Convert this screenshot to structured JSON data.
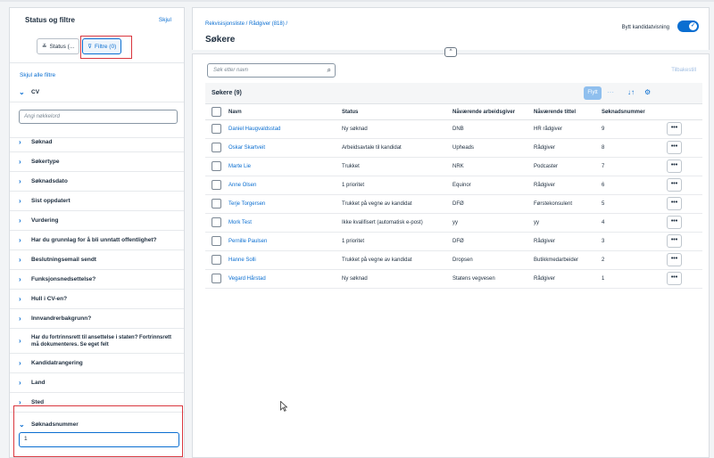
{
  "sidebar": {
    "title": "Status og filtre",
    "hide_label": "Skjul",
    "segments": [
      {
        "icon": "list-filter-icon",
        "glyph": "≚",
        "label": "Status (..."
      },
      {
        "icon": "funnel-icon",
        "glyph": "⊽",
        "label": "Filtre (0)"
      }
    ],
    "hide_all_label": "Skjul alle filtre",
    "cv_label": "CV",
    "keyword_placeholder": "Angi nøkkelord",
    "filters": [
      "Søknad",
      "Søkertype",
      "Søknadsdato",
      "Sist oppdatert",
      "Vurdering",
      "Har du grunnlag for å bli unntatt offentlighet?",
      "Beslutningsemail sendt",
      "Funksjonsnedsettelse?",
      "Hull i CV-en?",
      "Innvandrerbakgrunn?",
      "Har du fortrinnsrett til ansettelse i staten? Fortrinnsrett må dokumenteres. Se eget felt",
      "Kandidatrangering",
      "Land",
      "Sted"
    ],
    "expanded_filter": "Søknadsnummer",
    "expanded_value": "1"
  },
  "header": {
    "breadcrumb": "Rekvisisjonsliste / Rådgiver (818) /",
    "title": "Søkere",
    "switch_label": "Bytt kandidatvisning",
    "switch_glyph": "✓"
  },
  "toolbar": {
    "search_placeholder": "Søk etter navn",
    "reset_label": "Tilbakestill",
    "table_title": "Søkere (9)",
    "move_label": "Flytt",
    "more_glyph": "···",
    "sort_glyph": "↓↑",
    "settings_glyph": "⚙"
  },
  "table": {
    "columns": [
      "Navn",
      "Status",
      "Nåværende arbeidsgiver",
      "Nåværende tittel",
      "Søknadsnummer"
    ],
    "rows": [
      {
        "name": "Daniel Haugvaldsstad",
        "status": "Ny søknad",
        "employer": "DNB",
        "title": "HR rådgiver",
        "number": "9"
      },
      {
        "name": "Oskar Skartveit",
        "status": "Arbeidsavtale til kandidat",
        "employer": "Upheads",
        "title": "Rådgiver",
        "number": "8"
      },
      {
        "name": "Marte Lie",
        "status": "Trukket",
        "employer": "NRK",
        "title": "Podcaster",
        "number": "7"
      },
      {
        "name": "Anne Olsen",
        "status": "1 prioritet",
        "employer": "Equinor",
        "title": "Rådgiver",
        "number": "6"
      },
      {
        "name": "Terje Torgersen",
        "status": "Trukket på vegne av kandidat",
        "employer": "DFØ",
        "title": "Førstekonsulent",
        "number": "5"
      },
      {
        "name": "Mork Test",
        "status": "Ikke kvalifisert (automatisk e-post)",
        "employer": "yy",
        "title": "yy",
        "number": "4"
      },
      {
        "name": "Pernille Paulsen",
        "status": "1 prioritet",
        "employer": "DFØ",
        "title": "Rådgiver",
        "number": "3"
      },
      {
        "name": "Hanne Solli",
        "status": "Trukket på vegne av kandidat",
        "employer": "Dropsen",
        "title": "Butikkmedarbeider",
        "number": "2"
      },
      {
        "name": "Vegard Hårstad",
        "status": "Ny søknad",
        "employer": "Statens vegvesen",
        "title": "Rådgiver",
        "number": "1"
      }
    ],
    "row_action_glyph": "•••"
  },
  "colors": {
    "accent": "#0a6ed1",
    "highlight": "#d9363e"
  }
}
